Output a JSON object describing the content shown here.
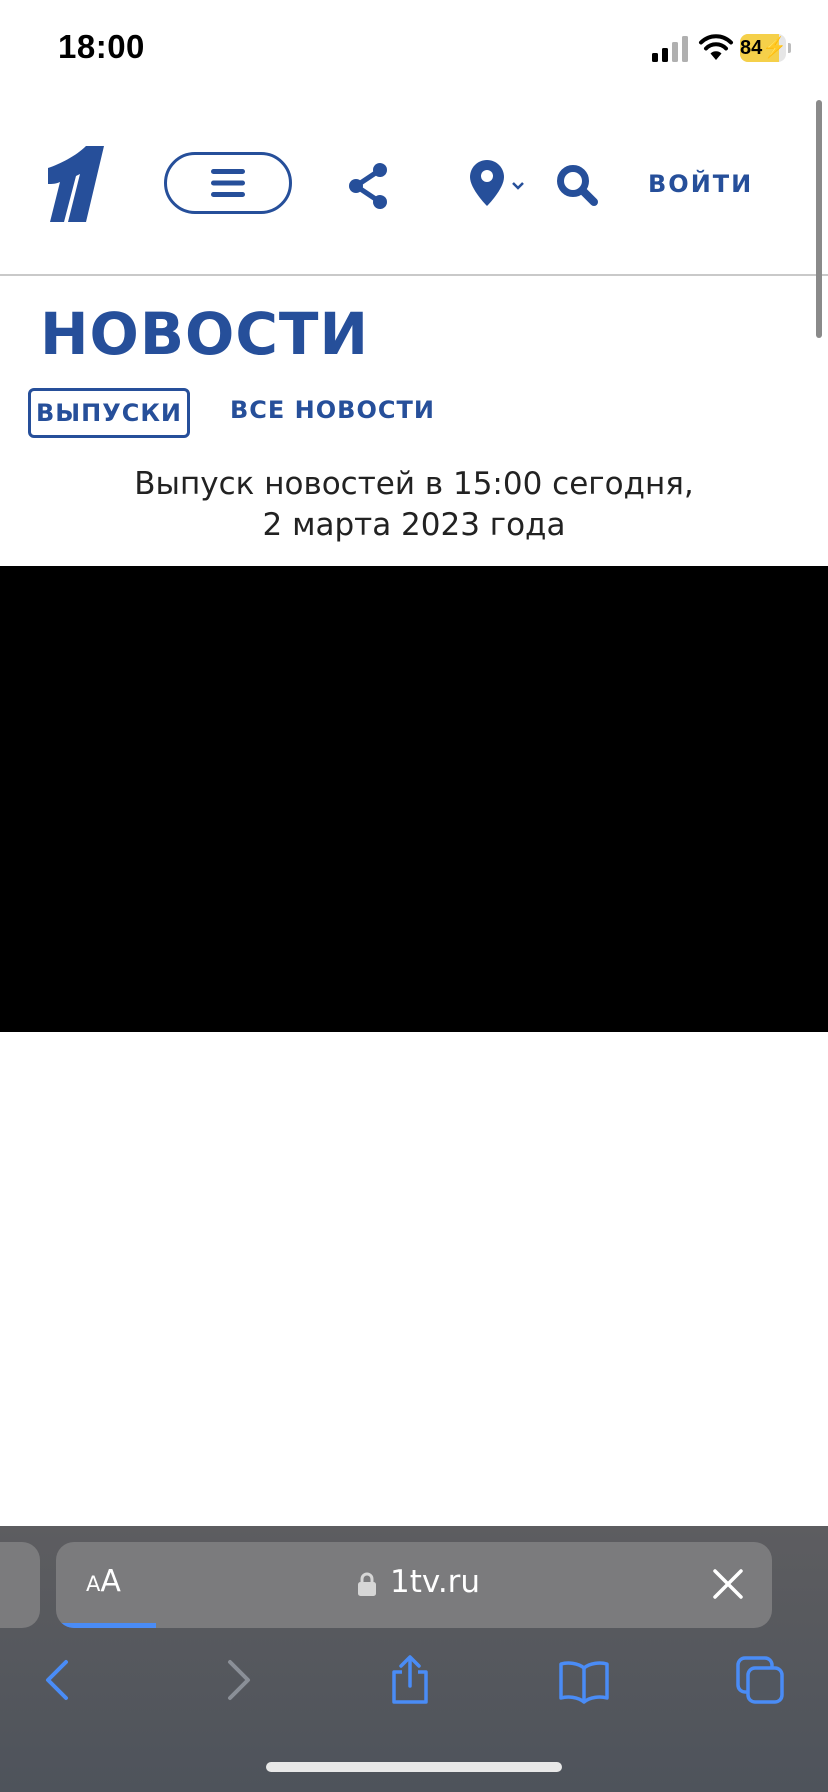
{
  "status_bar": {
    "time": "18:00",
    "battery_level": "84",
    "battery_label": "84",
    "charging": true
  },
  "header": {
    "login_label": "ВОЙТИ",
    "icons": [
      "channel-one-logo",
      "menu-icon",
      "share-icon",
      "location-pin-icon",
      "search-icon"
    ]
  },
  "page": {
    "title": "НОВОСТИ",
    "tabs": [
      {
        "label": "ВЫПУСКИ",
        "active": true
      },
      {
        "label": "ВСЕ НОВОСТИ",
        "active": false
      }
    ],
    "release_title_line1": "Выпуск новостей в 15:00 сегодня,",
    "release_title_line2": "2 марта 2023 года"
  },
  "browser": {
    "text_size_small": "A",
    "text_size_large": "A",
    "url": "1tv.ru",
    "load_progress": 0.14,
    "toolbar_icons": [
      "back-icon",
      "forward-icon",
      "share-icon",
      "bookmarks-icon",
      "tabs-icon"
    ]
  },
  "colors": {
    "brand_blue": "#264f9a",
    "browser_accent": "#4a8cf6",
    "battery_fill": "#f5d04a"
  }
}
